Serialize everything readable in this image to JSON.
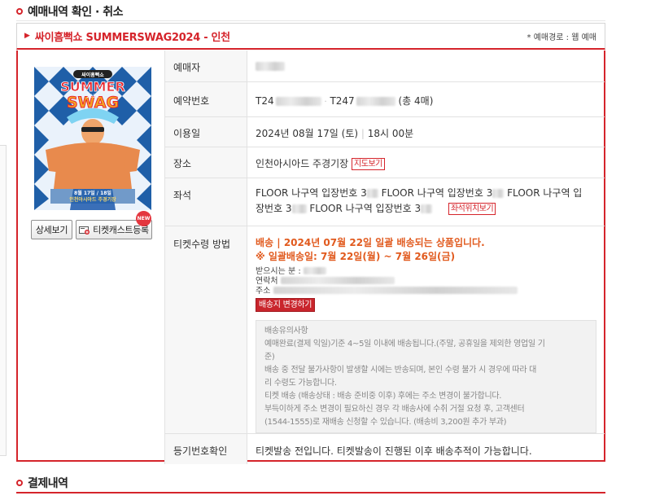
{
  "section": {
    "title": "예매내역 확인 · 취소",
    "payment_title": "결제내역"
  },
  "event": {
    "name": "싸이흠뻑쇼 SUMMERSWAG2024 - 인천",
    "route": "* 예매경로 : 웹 예매"
  },
  "poster": {
    "brand": "싸이흠뻑쇼",
    "line1": "SUMMER",
    "line2": "SWAG",
    "year": "2024",
    "date_text": "8월 17일 / 18일",
    "venue_text": "인천아시아드 주경기장"
  },
  "buttons": {
    "detail": "상세보기",
    "ticketcast": "티켓캐스트등록",
    "new_badge": "NEW"
  },
  "rows": {
    "booker_label": "예매자",
    "reservation_label": "예약번호",
    "reservation_prefix1": "T24",
    "reservation_prefix2": "T247",
    "reservation_suffix": "(총 4매)",
    "date_label": "이용일",
    "date_value": "2024년 08월 17일 (토)",
    "date_sep": "|",
    "time_value": "18시 00분",
    "place_label": "장소",
    "place_value": "인천아시아드 주경기장",
    "map_btn": "지도보기",
    "seat_label": "좌석",
    "seat_part1": "FLOOR 나구역 입장번호 3",
    "seat_part2": "FLOOR 나구역 입장번호 3",
    "seat_part3": "FLOOR 나구역 입",
    "seat_part4": "장번호 3",
    "seat_part5": "FLOOR 나구역 입장번호 3",
    "seat_map_btn": "좌석위치보기",
    "ticket_method_label": "티켓수령 방법",
    "delivery_line": "배송 | 2024년 07월 22일 일괄 배송되는 상품입니다.",
    "delivery_note": "※ 일괄배송일: 7월 22일(월) ~ 7월 26일(금)",
    "recipient_label": "받으시는 분 :",
    "contact_label": "연락처",
    "address_label": "주소",
    "change_addr_btn": "배송지 변경하기",
    "notice_title": "배송유의사항",
    "notice_lines": [
      "예매완료(결제 익일)기준 4~5일 이내에 배송됩니다.(주말, 공휴일을 제외한 영업일 기",
      "준)",
      "배송 중 전달 불가사항이 발생할 시에는 반송되며, 본인 수령 불가 시 경우에 따라 대",
      "리 수령도 가능합니다.",
      "티켓 배송 (배송상태 : 배송 준비중 이후) 후에는 주소 변경이 불가합니다.",
      "부득이하게 주소 변경이 필요하신 경우 각 배송사에 수취 거절 요청 후, 고객센터",
      "(1544-1555)로 재배송 신청할 수 있습니다. (배송비 3,200원 추가 부과)"
    ],
    "tracking_label": "등기번호확인",
    "tracking_value": "티켓발송 전입니다. 티켓발송이 진행된 이후 배송추적이 가능합니다."
  },
  "colors": {
    "accent": "#d5242b",
    "orange": "#e15a1e"
  }
}
